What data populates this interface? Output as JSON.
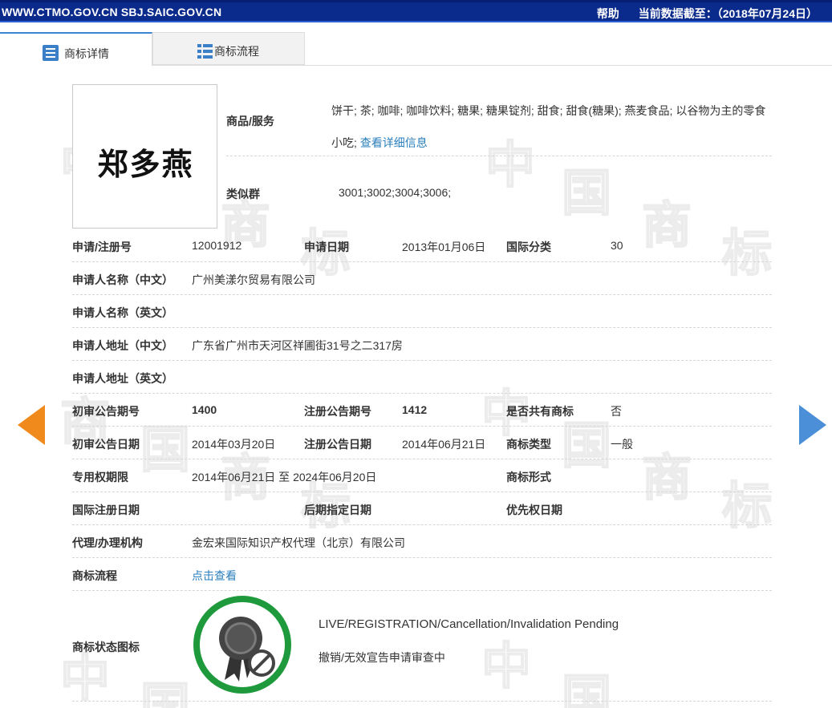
{
  "topbar": {
    "site": "WWW.CTMO.GOV.CN SBJ.SAIC.GOV.CN",
    "help": "帮助",
    "data_cutoff": "当前数据截至：（2018年07月24日）"
  },
  "tabs": [
    {
      "label": "商标详情",
      "icon": "document-list-icon"
    },
    {
      "label": "商标流程",
      "icon": "grid-list-icon"
    }
  ],
  "watermark": {
    "chars": [
      "中",
      "国",
      "商",
      "标"
    ]
  },
  "trademark": {
    "mark_text": "郑多燕"
  },
  "goods": {
    "label": "商品/服务",
    "text": "饼干; 茶; 咖啡; 咖啡饮料; 糖果; 糖果锭剂; 甜食; 甜食(糖果); 燕麦食品; 以谷物为主的零食小吃;",
    "detail_link": "查看详细信息"
  },
  "similar_group": {
    "label": "类似群",
    "value": "3001;3002;3004;3006;"
  },
  "fields": {
    "reg_no_label": "申请/注册号",
    "reg_no": "12001912",
    "apply_date_label": "申请日期",
    "apply_date": "2013年01月06日",
    "intl_class_label": "国际分类",
    "intl_class": "30",
    "applicant_cn_label": "申请人名称（中文）",
    "applicant_cn": "广州美漾尔贸易有限公司",
    "applicant_en_label": "申请人名称（英文）",
    "applicant_en": "",
    "address_cn_label": "申请人地址（中文）",
    "address_cn": "广东省广州市天河区祥圃街31号之二317房",
    "address_en_label": "申请人地址（英文）",
    "address_en": "",
    "prelim_no_label": "初审公告期号",
    "prelim_no": "1400",
    "reg_pub_no_label": "注册公告期号",
    "reg_pub_no": "1412",
    "shared_label": "是否共有商标",
    "shared": "否",
    "prelim_date_label": "初审公告日期",
    "prelim_date": "2014年03月20日",
    "reg_pub_date_label": "注册公告日期",
    "reg_pub_date": "2014年06月21日",
    "tm_type_label": "商标类型",
    "tm_type": "一般",
    "exclusive_label": "专用权期限",
    "exclusive": "2014年06月21日 至 2024年06月20日",
    "tm_form_label": "商标形式",
    "tm_form": "",
    "intl_reg_date_label": "国际注册日期",
    "intl_reg_date": "",
    "later_date_label": "后期指定日期",
    "later_date": "",
    "priority_date_label": "优先权日期",
    "priority_date": "",
    "agent_label": "代理/办理机构",
    "agent": "金宏来国际知识产权代理（北京）有限公司",
    "flow_label": "商标流程",
    "flow_link": "点击查看"
  },
  "status": {
    "label": "商标状态图标",
    "en": "LIVE/REGISTRATION/Cancellation/Invalidation Pending",
    "cn": "撤销/无效宣告申请审查中",
    "icon": "award-badge-cancel-icon",
    "ring_color": "#1e9a3c"
  },
  "nav": {
    "prev_color": "#f08a1c",
    "next_color": "#4a8fd8"
  }
}
